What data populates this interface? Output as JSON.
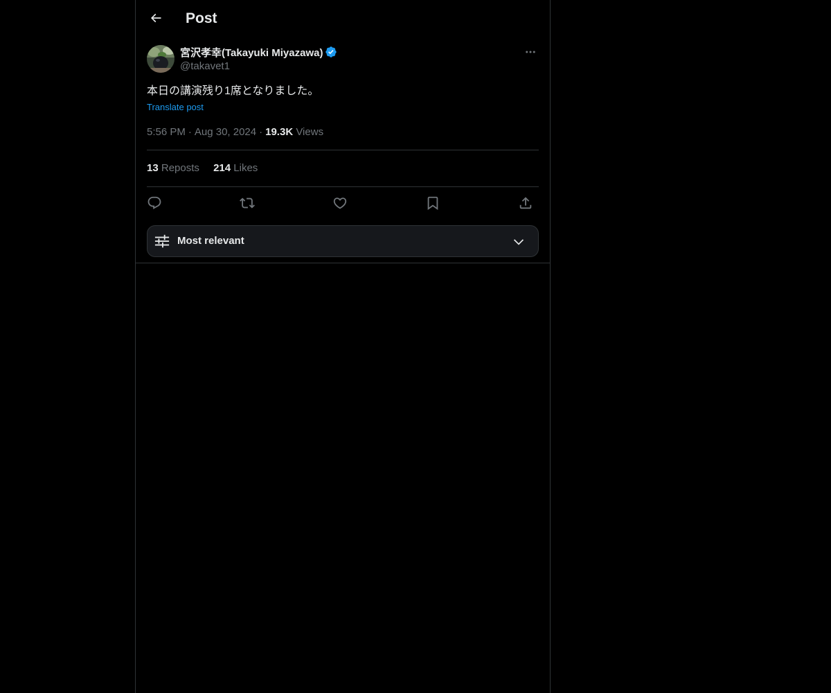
{
  "header": {
    "title": "Post",
    "back_icon": "arrow-left-icon"
  },
  "post": {
    "author": {
      "display_name": "宮沢孝幸(Takayuki Miyazawa)",
      "handle": "@takavet1",
      "verified": true,
      "verified_color": "#1d9bf0"
    },
    "text": "本日の講演残り1席となりました。",
    "translate_label": "Translate post",
    "time": "5:56 PM",
    "separator": "·",
    "date": "Aug 30, 2024",
    "views_count": "19.3K",
    "views_label": "Views"
  },
  "stats": {
    "reposts_count": "13",
    "reposts_label": "Reposts",
    "likes_count": "214",
    "likes_label": "Likes"
  },
  "actions": [
    "reply-icon",
    "repost-icon",
    "like-icon",
    "bookmark-icon",
    "share-icon"
  ],
  "sort": {
    "label": "Most relevant",
    "icon": "sliders-icon",
    "chevron": "chevron-down-icon"
  },
  "colors": {
    "background": "#000000",
    "text_primary": "#e7e9ea",
    "text_secondary": "#71767b",
    "accent": "#1d9bf0",
    "border": "#2f3336"
  }
}
